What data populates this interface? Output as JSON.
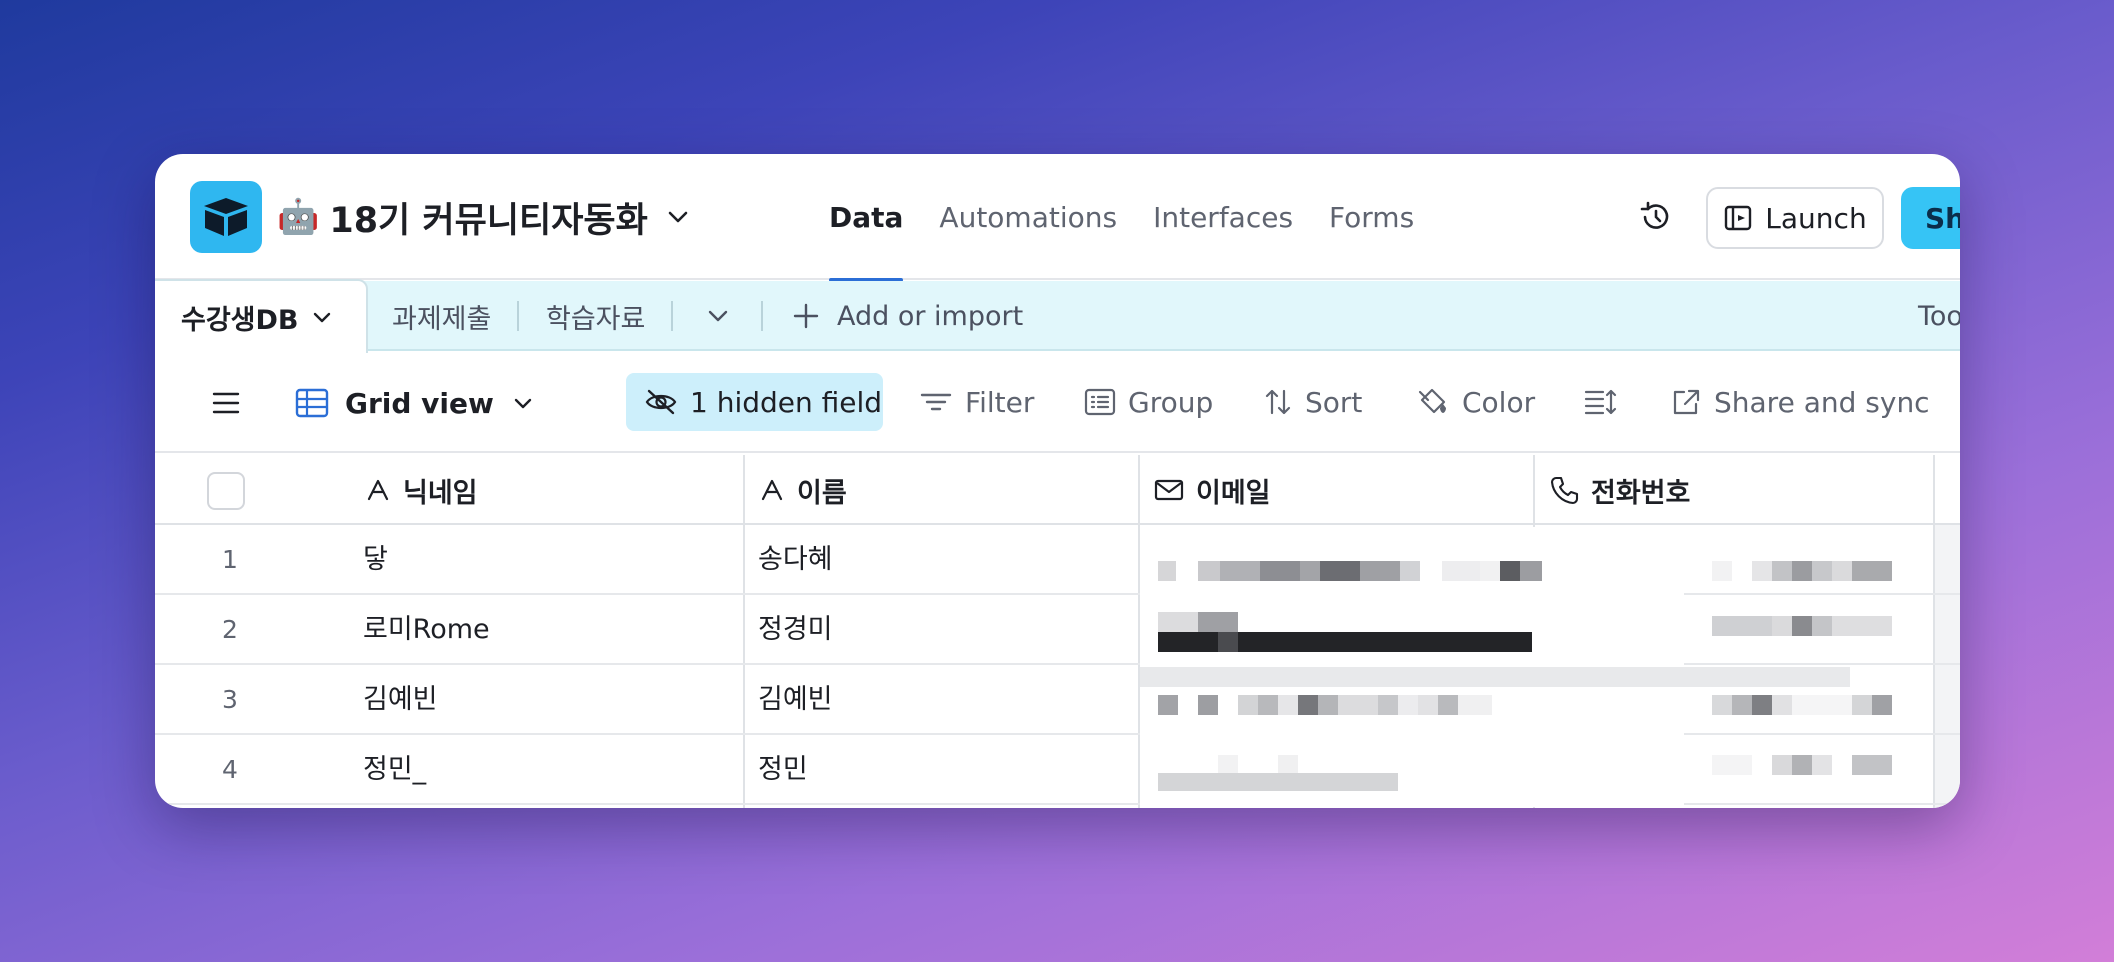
{
  "app": {
    "base_emoji": "🤖",
    "base_name": "18기 커뮤니티자동화"
  },
  "main_tabs": [
    {
      "label": "Data",
      "active": true
    },
    {
      "label": "Automations",
      "active": false
    },
    {
      "label": "Interfaces",
      "active": false
    },
    {
      "label": "Forms",
      "active": false
    }
  ],
  "header_actions": {
    "launch_label": "Launch",
    "share_label": "Sh"
  },
  "table_tabs": {
    "active": "수강생DB",
    "others": [
      "과제제출",
      "학습자료"
    ],
    "add_label": "Add or import",
    "tools_label": "Too"
  },
  "view_toolbar": {
    "view_name": "Grid view",
    "hidden_fields_label": "1 hidden field",
    "filter_label": "Filter",
    "group_label": "Group",
    "sort_label": "Sort",
    "color_label": "Color",
    "share_sync_label": "Share and sync"
  },
  "columns": [
    {
      "name": "닉네임",
      "icon": "text-field-icon"
    },
    {
      "name": "이름",
      "icon": "text-field-icon"
    },
    {
      "name": "이메일",
      "icon": "email-icon"
    },
    {
      "name": "전화번호",
      "icon": "phone-icon"
    }
  ],
  "rows": [
    {
      "num": "1",
      "nickname": "닿",
      "name": "송다혜"
    },
    {
      "num": "2",
      "nickname": "로미Rome",
      "name": "정경미"
    },
    {
      "num": "3",
      "nickname": "김예빈",
      "name": "김예빈"
    },
    {
      "num": "4",
      "nickname": "정민_",
      "name": "정민"
    }
  ],
  "colors": {
    "accent": "#2b6ed6",
    "logo_bg": "#2fb7f0",
    "share_button": "#36c4f5",
    "table_bar_bg": "#e1f7fb",
    "hidden_field_bg": "#cdeffb"
  }
}
